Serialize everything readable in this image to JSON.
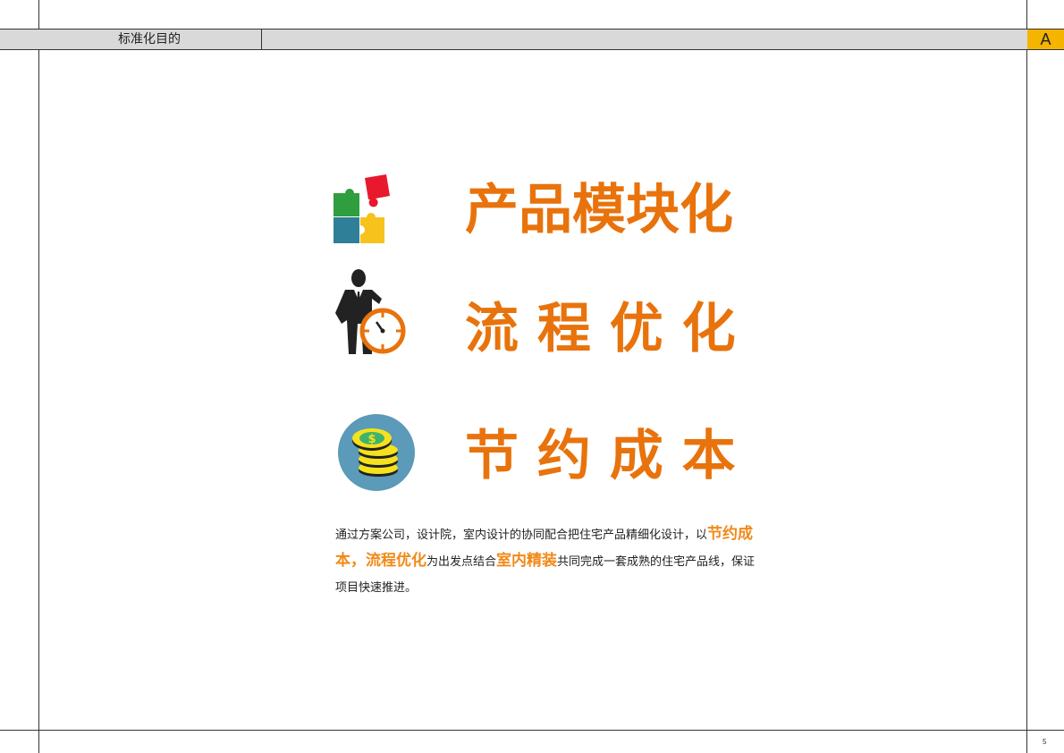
{
  "header": {
    "title": "标准化目的",
    "section_letter": "A"
  },
  "features": [
    {
      "title": "产品模块化",
      "icon": "puzzle-icon"
    },
    {
      "title": "流 程 优 化",
      "icon": "businessman-clock-icon"
    },
    {
      "title": "节 约 成 本",
      "icon": "coins-icon"
    }
  ],
  "description": {
    "part1": "通过方案公司，设计院，室内设计的协同配合把住宅产品精细化设计，以",
    "highlight1": "节约成本，流程优化",
    "part2": "为出发点结合",
    "highlight2": "室内精装",
    "part3": "共同完成一套成熟的住宅产品线，保证项目快速推进。"
  },
  "footer": {
    "page_number": "5"
  },
  "colors": {
    "accent_orange": "#e8730c",
    "badge_yellow": "#f5b400",
    "header_gray": "#d9d9d9"
  }
}
